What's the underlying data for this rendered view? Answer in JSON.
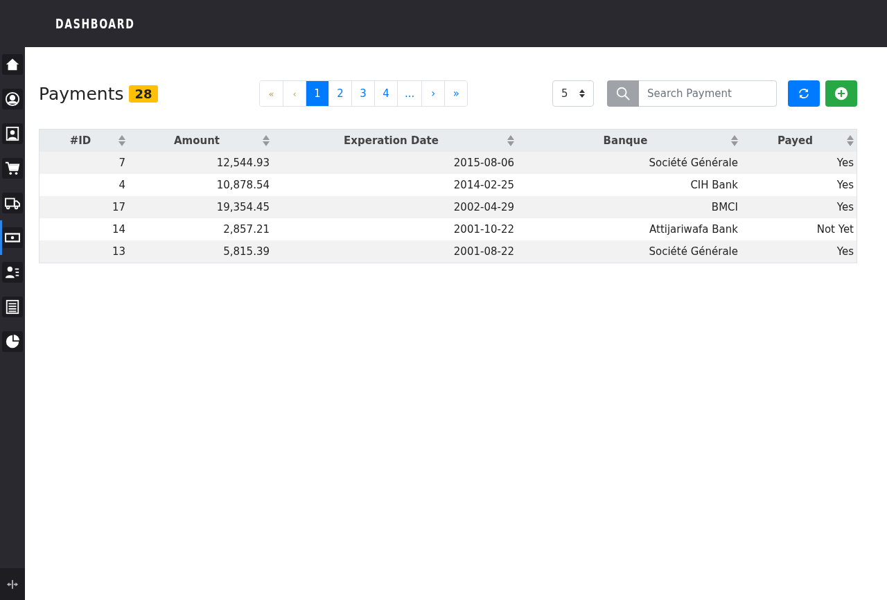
{
  "header": {
    "title": "DASHBOARD"
  },
  "sidebar": {
    "items": [
      {
        "selected": false
      },
      {
        "selected": false
      },
      {
        "selected": false
      },
      {
        "selected": false
      },
      {
        "selected": false
      },
      {
        "selected": true
      },
      {
        "selected": false
      },
      {
        "selected": false
      },
      {
        "selected": false
      }
    ]
  },
  "page": {
    "title": "Payments",
    "count": "28"
  },
  "pagination": [
    {
      "label": "«",
      "selected": false,
      "disabled": true
    },
    {
      "label": "‹",
      "selected": false,
      "disabled": true
    },
    {
      "label": "1",
      "selected": true,
      "disabled": false
    },
    {
      "label": "2",
      "selected": false,
      "disabled": false
    },
    {
      "label": "3",
      "selected": false,
      "disabled": false
    },
    {
      "label": "4",
      "selected": false,
      "disabled": false
    },
    {
      "label": "...",
      "selected": false,
      "disabled": false
    },
    {
      "label": "›",
      "selected": false,
      "disabled": false
    },
    {
      "label": "»",
      "selected": false,
      "disabled": false
    }
  ],
  "page_size": {
    "value": "5"
  },
  "search": {
    "placeholder": "Search Payment"
  },
  "table": {
    "columns": [
      "#ID",
      "Amount",
      "Experation Date",
      "Banque",
      "Payed"
    ],
    "rows": [
      [
        "7",
        "12,544.93",
        "2015-08-06",
        "Société Générale",
        "Yes"
      ],
      [
        "4",
        "10,878.54",
        "2014-02-25",
        "CIH Bank",
        "Yes"
      ],
      [
        "17",
        "19,354.45",
        "2002-04-29",
        "BMCI",
        "Yes"
      ],
      [
        "14",
        "2,857.21",
        "2001-10-22",
        "Attijariwafa Bank",
        "Not Yet"
      ],
      [
        "13",
        "5,815.39",
        "2001-08-22",
        "Société Générale",
        "Yes"
      ]
    ]
  }
}
